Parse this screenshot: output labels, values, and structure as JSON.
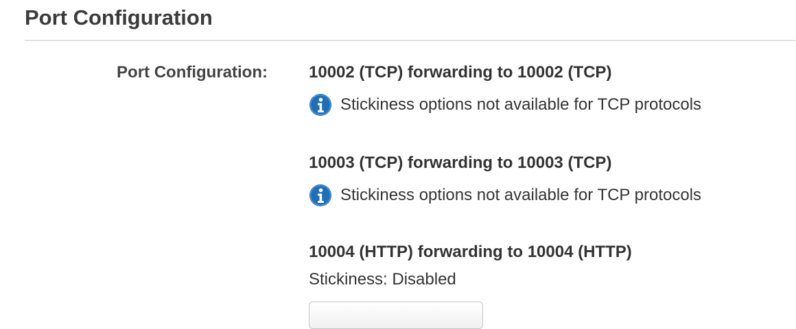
{
  "section": {
    "title": "Port Configuration"
  },
  "field": {
    "label": "Port Configuration:"
  },
  "listeners": [
    {
      "title": "10002 (TCP) forwarding to 10002 (TCP)",
      "note": "Stickiness options not available for TCP protocols",
      "note_icon": "info-icon"
    },
    {
      "title": "10003 (TCP) forwarding to 10003 (TCP)",
      "note": "Stickiness options not available for TCP protocols",
      "note_icon": "info-icon"
    },
    {
      "title": "10004 (HTTP) forwarding to 10004 (HTTP)",
      "stickiness": "Stickiness: Disabled"
    }
  ],
  "colors": {
    "info_icon": "#1f6fb8",
    "divider": "#e1e1e1",
    "text": "#333333"
  }
}
